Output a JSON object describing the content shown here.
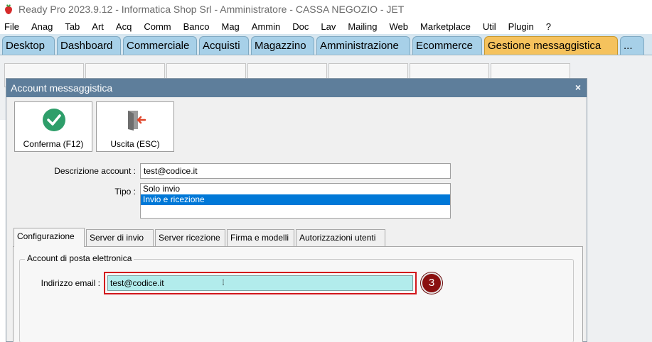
{
  "window": {
    "title": "Ready Pro 2023.9.12 - Informatica Shop Srl - Amministratore - CASSA NEGOZIO - JET"
  },
  "menu": [
    "File",
    "Anag",
    "Tab",
    "Art",
    "Acq",
    "Comm",
    "Banco",
    "Mag",
    "Ammin",
    "Doc",
    "Lav",
    "Mailing",
    "Web",
    "Marketplace",
    "Util",
    "Plugin",
    "?"
  ],
  "main_tabs": [
    {
      "label": "Desktop",
      "active": false
    },
    {
      "label": "Dashboard",
      "active": false
    },
    {
      "label": "Commerciale",
      "active": false
    },
    {
      "label": "Acquisti",
      "active": false
    },
    {
      "label": "Magazzino",
      "active": false
    },
    {
      "label": "Amministrazione",
      "active": false
    },
    {
      "label": "Ecommerce",
      "active": false
    },
    {
      "label": "Gestione messaggistica",
      "active": true
    },
    {
      "label": "...",
      "active": false
    }
  ],
  "dialog": {
    "title": "Account messaggistica",
    "close_label": "×",
    "buttons": {
      "confirm": "Conferma (F12)",
      "exit": "Uscita (ESC)"
    },
    "fields": {
      "description_label": "Descrizione account :",
      "description_value": "test@codice.it",
      "type_label": "Tipo :",
      "type_options": [
        {
          "label": "Solo invio",
          "selected": false
        },
        {
          "label": "Invio e ricezione",
          "selected": true
        }
      ]
    },
    "tabs": [
      {
        "label": "Configurazione",
        "active": true
      },
      {
        "label": "Server di invio",
        "active": false
      },
      {
        "label": "Server ricezione",
        "active": false
      },
      {
        "label": "Firma e modelli",
        "active": false
      },
      {
        "label": "Autorizzazioni utenti",
        "active": false
      }
    ],
    "group": {
      "title": "Account di posta elettronica",
      "email_label": "Indirizzo email :",
      "email_value": "test@codice.it"
    },
    "step_badge": "3"
  },
  "colors": {
    "active_tab": "#f5c25d",
    "inactive_tab": "#a7d0e8",
    "dialog_header": "#5e7e9b",
    "confirm_icon": "#2e9e6a",
    "exit_icon_arrow": "#e0452a",
    "highlight": "#d2161c",
    "badge": "#8a1010",
    "email_field": "#b2ecec",
    "list_selection": "#0078d7"
  },
  "icons": {
    "app": "strawberry-icon",
    "confirm": "check-circle-icon",
    "exit": "door-exit-icon",
    "caret": "text-cursor-icon"
  }
}
